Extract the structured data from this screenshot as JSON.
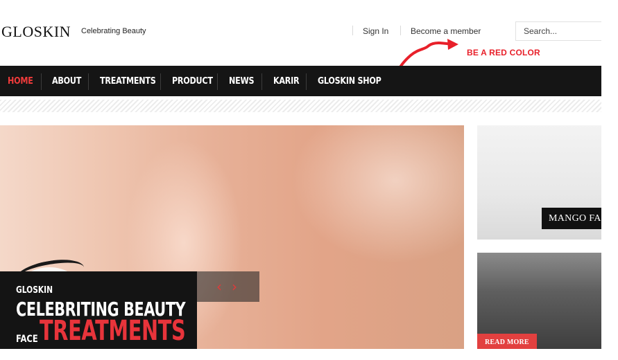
{
  "header": {
    "logo": "GLOSKIN",
    "tagline": "Celebrating Beauty",
    "sign_in": "Sign In",
    "become_member": "Become a member",
    "search_placeholder": "Search..."
  },
  "annotation": {
    "text": "BE A RED COLOR",
    "color": "#e8202a"
  },
  "nav": {
    "items": [
      "HOME",
      "ABOUT",
      "TREATMENTS",
      "PRODUCT",
      "NEWS",
      "KARIR",
      "GLOSKIN SHOP"
    ],
    "active": "HOME",
    "active_color": "#ef3b3b",
    "background": "#151515"
  },
  "slider": {
    "brand": "GLOSKIN",
    "title": "CELEBRITING BEAUTY",
    "face": "FACE",
    "subtitle": "TREATMENTS",
    "prev_icon": "‹",
    "next_icon": "›",
    "accent": "#e8343b"
  },
  "side_cards": [
    {
      "label": "MANGO FA"
    },
    {
      "button": "READ MORE",
      "button_color": "#e2403f"
    }
  ]
}
